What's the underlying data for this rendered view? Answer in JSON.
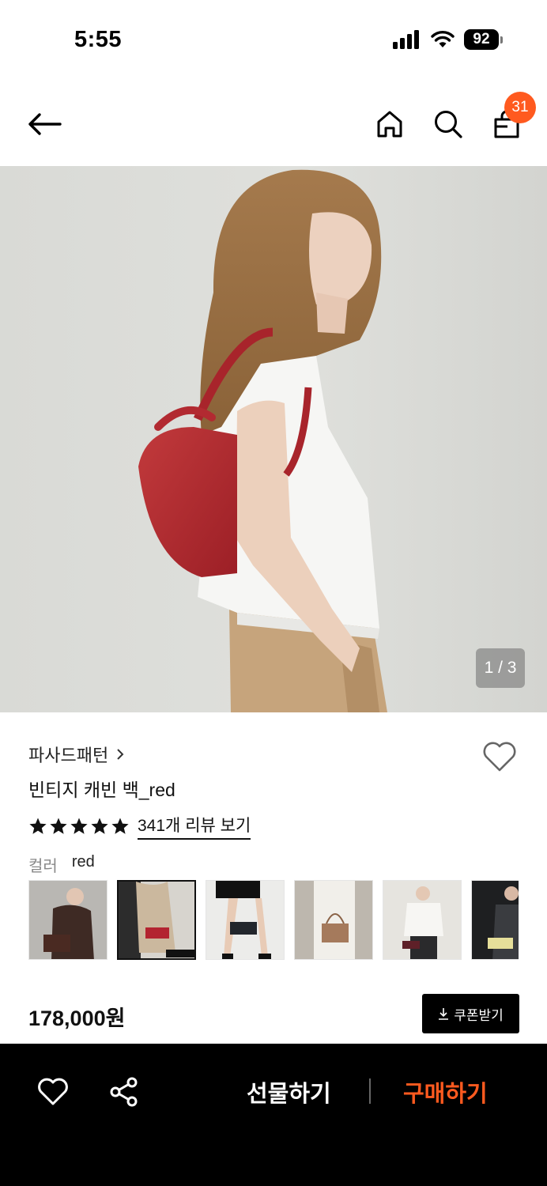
{
  "status_bar": {
    "time": "5:55",
    "battery": "92"
  },
  "nav": {
    "cart_count": "31"
  },
  "gallery": {
    "counter": "1 / 3"
  },
  "product": {
    "brand": "파사드패턴",
    "name": "빈티지 캐빈 백_red",
    "rating_stars": 5,
    "review_link": "341개 리뷰 보기",
    "color_label": "컬러",
    "color_value": "red",
    "price": "178,000원",
    "coupon_label": "쿠폰받기"
  },
  "color_options": [
    {
      "name": "brown",
      "swatch": "#4a2a22",
      "selected": false
    },
    {
      "name": "red",
      "swatch": "#b32430",
      "selected": true
    },
    {
      "name": "black",
      "swatch": "#22262c",
      "selected": false
    },
    {
      "name": "tan",
      "swatch": "#a57a5c",
      "selected": false
    },
    {
      "name": "burgundy",
      "swatch": "#5e2028",
      "selected": false
    },
    {
      "name": "butter",
      "swatch": "#e6df9a",
      "selected": false
    }
  ],
  "bottom_bar": {
    "gift_label": "선물하기",
    "buy_label": "구매하기"
  },
  "colors": {
    "accent": "#ff5a1f",
    "bottom_bar_bg": "#000000"
  }
}
